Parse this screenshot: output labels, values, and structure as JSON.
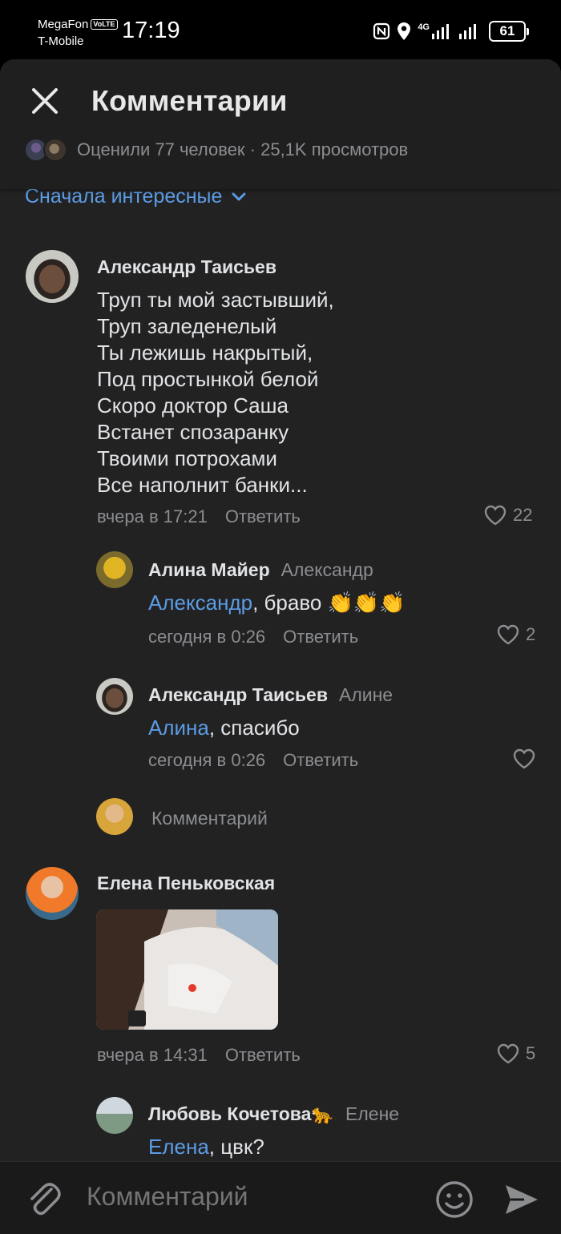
{
  "status_bar": {
    "carrier1": "MegaFon",
    "volte": "VoLTE",
    "carrier2": "T-Mobile",
    "time": "17:19",
    "network": "4G",
    "battery": "61"
  },
  "header": {
    "title": "Комментарии",
    "rated_text": "Оценили 77 человек · 25,1K просмотров"
  },
  "sort": {
    "label": "Сначала интересные"
  },
  "comments": [
    {
      "author": "Александр Таисьев",
      "lines": [
        "Труп ты мой застывший,",
        "Труп заледенелый",
        "Ты лежишь накрытый,",
        "Под простынкой белой",
        "Скоро доктор Саша",
        "Встанет спозаранку",
        "Твоими потрохами",
        "Все наполнит банки..."
      ],
      "date": "вчера в 17:21",
      "reply": "Ответить",
      "likes": "22"
    },
    {
      "author": "Алина Майер",
      "to": "Александр",
      "mention": "Александр",
      "text": ", браво 👏👏👏",
      "date": "сегодня в 0:26",
      "reply": "Ответить",
      "likes": "2"
    },
    {
      "author": "Александр Таисьев",
      "to": "Алине",
      "mention": "Алина",
      "text": ", спасибо",
      "date": "сегодня в 0:26",
      "reply": "Ответить",
      "likes": ""
    },
    {
      "author": "Елена Пеньковская",
      "date": "вчера в 14:31",
      "reply": "Ответить",
      "likes": "5"
    },
    {
      "author": "Любовь Кочетова🐆",
      "to": "Елене",
      "mention": "Елена",
      "text": ", цвк?"
    }
  ],
  "reply_input": {
    "placeholder": "Комментарий"
  },
  "bottom_bar": {
    "placeholder": "Комментарий"
  },
  "colors": {
    "accent": "#5c9ce6",
    "background": "#222222",
    "secondary_text": "#8b8d91"
  },
  "icons": [
    "close-icon",
    "chevron-down-icon",
    "heart-icon",
    "paperclip-icon",
    "emoji-icon",
    "send-icon"
  ]
}
